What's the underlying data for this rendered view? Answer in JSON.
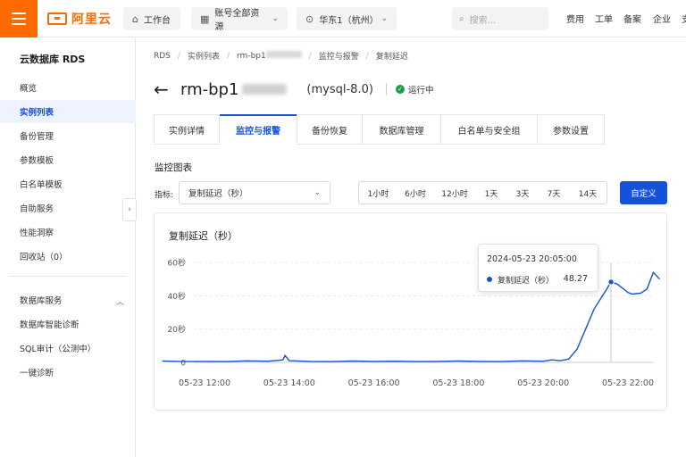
{
  "topbar": {
    "logo_text": "阿里云",
    "workbench": "工作台",
    "account_scope": "账号全部资源",
    "region": "华东1（杭州）",
    "search_placeholder": "搜索...",
    "nav": [
      "费用",
      "工单",
      "备案",
      "企业",
      "支"
    ],
    "brand_color": "#ff6a00"
  },
  "sidebar": {
    "title": "云数据库 RDS",
    "items": [
      "概览",
      "实例列表",
      "备份管理",
      "参数模板",
      "白名单模板",
      "自助服务",
      "性能洞察",
      "回收站（0）"
    ],
    "active_index": 1,
    "group_title": "数据库服务",
    "group_items": [
      "数据库智能诊断",
      "SQL审计（公测中）",
      "一键诊断"
    ]
  },
  "breadcrumb": [
    "RDS",
    "实例列表",
    "rm-bp1",
    "监控与报警",
    "复制延迟"
  ],
  "instance": {
    "name": "rm-bp1",
    "version": "(mysql-8.0)",
    "status": "运行中",
    "status_color": "#1f9e4a"
  },
  "tabs": [
    "实例详情",
    "监控与报警",
    "备份恢复",
    "数据库管理",
    "白名单与安全组",
    "参数设置"
  ],
  "active_tab": 1,
  "monitor": {
    "section_title": "监控图表",
    "metric_label": "指标:",
    "metric_value": "复制延迟（秒）",
    "ranges": [
      "1小时",
      "6小时",
      "12小时",
      "1天",
      "3天",
      "7天",
      "14天"
    ],
    "custom_button": "自定义",
    "accent_color": "#1652d9"
  },
  "chart_data": {
    "type": "line",
    "title": "复制延迟（秒）",
    "ytick_labels": [
      "0",
      "20秒",
      "40秒",
      "60秒"
    ],
    "ylim": [
      0,
      60
    ],
    "xtick_labels": [
      "05-23 12:00",
      "05-23 14:00",
      "05-23 16:00",
      "05-23 18:00",
      "05-23 20:00",
      "05-23 22:00"
    ],
    "x_hours": [
      11.0,
      11.5,
      12.0,
      12.5,
      13.0,
      13.5,
      13.85,
      13.9,
      14.0,
      14.5,
      15.0,
      15.5,
      16.0,
      16.5,
      17.0,
      17.5,
      18.0,
      18.5,
      19.0,
      19.5,
      20.0,
      20.2,
      20.4,
      20.6,
      20.8,
      21.0,
      21.2,
      21.4,
      21.5,
      21.6,
      21.75,
      21.9,
      22.0,
      22.1,
      22.3,
      22.45,
      22.6,
      22.75
    ],
    "values": [
      0.8,
      0.5,
      0.6,
      0.5,
      0.9,
      0.7,
      1.5,
      4.2,
      1.0,
      0.6,
      0.5,
      0.8,
      0.6,
      0.7,
      0.5,
      0.6,
      0.8,
      0.6,
      0.5,
      0.9,
      0.7,
      1.5,
      1.0,
      2.0,
      8.0,
      20.0,
      32.0,
      40.0,
      44.0,
      48.3,
      47.0,
      44.0,
      42.0,
      41.0,
      41.5,
      44.0,
      54.0,
      50.0
    ],
    "grid": "horizontal",
    "tooltip": {
      "time": "2024-05-23 20:05:00",
      "series": "复制延迟（秒）",
      "value": "48.27",
      "x_hour": 21.6
    }
  }
}
